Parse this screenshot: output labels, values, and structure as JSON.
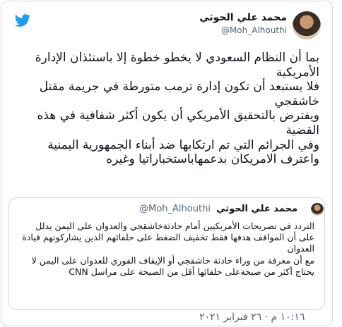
{
  "author": {
    "name": "محمد علي الحوثي",
    "handle": "@Moh_Alhouthi"
  },
  "tweet": {
    "lines": [
      "بما أن النظام السعودي لا يخطو خطوة إلا باستئذان الإدارة الأمريكية",
      "فلا يستبعد أن تكون إدارة ترمب متورطة في جريمة مقتل خاشقجي",
      "ويفترض بالتحقيق الأمريكي أن يكون أكثر شفافية في هذه القضية",
      "وفي الجرائم التي تم ارتكابها ضد أبناء الجمهورية اليمنية واعترف الامريكان بدعمهاباستخباراتيا وغيره"
    ]
  },
  "quote": {
    "name": "محمد علي الحوثي",
    "handle": "@Moh_Alhouthi",
    "lines": [
      "التردد في تصريحات الأمريكيين أمام حادثةخاشقجي والعدوان على اليمن يدلل على أن المواقف هدفها فقط تخفيف الضغط على حلفائهم الذين يشاركونهم قيادة العدوان",
      "مع أن معرفة من وراء حادثة خاشقجي أو الإيقاف الفوري للعدوان على اليمن لا يحتاج أكثر من صيحةعلى حلفائها أقل من الصيحة على مراسل CNN"
    ]
  },
  "timestamp": "١٠:١٦ م · ٢٦ فبراير ٢٠٢١",
  "colors": {
    "twitter_blue": "#1d9bf0",
    "border": "#cfd9de",
    "muted": "#536471"
  },
  "icons": {
    "logo": "twitter-bird-icon"
  }
}
